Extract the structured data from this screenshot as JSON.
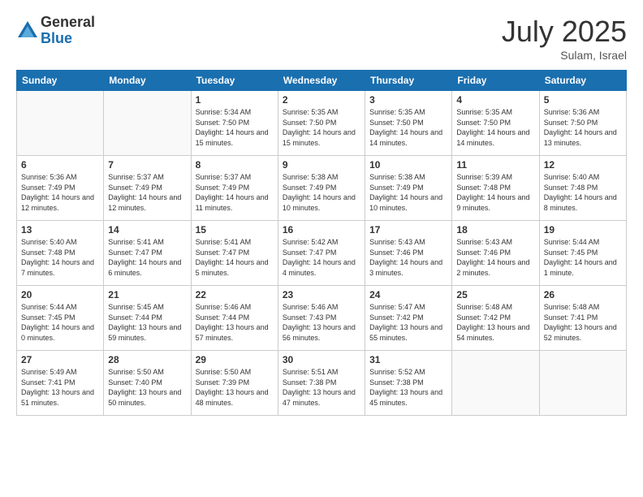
{
  "logo": {
    "general": "General",
    "blue": "Blue"
  },
  "title": "July 2025",
  "location": "Sulam, Israel",
  "days_of_week": [
    "Sunday",
    "Monday",
    "Tuesday",
    "Wednesday",
    "Thursday",
    "Friday",
    "Saturday"
  ],
  "weeks": [
    [
      {
        "day": null
      },
      {
        "day": null
      },
      {
        "day": 1,
        "sunrise": "5:34 AM",
        "sunset": "7:50 PM",
        "daylight": "14 hours and 15 minutes."
      },
      {
        "day": 2,
        "sunrise": "5:35 AM",
        "sunset": "7:50 PM",
        "daylight": "14 hours and 15 minutes."
      },
      {
        "day": 3,
        "sunrise": "5:35 AM",
        "sunset": "7:50 PM",
        "daylight": "14 hours and 14 minutes."
      },
      {
        "day": 4,
        "sunrise": "5:35 AM",
        "sunset": "7:50 PM",
        "daylight": "14 hours and 14 minutes."
      },
      {
        "day": 5,
        "sunrise": "5:36 AM",
        "sunset": "7:50 PM",
        "daylight": "14 hours and 13 minutes."
      }
    ],
    [
      {
        "day": 6,
        "sunrise": "5:36 AM",
        "sunset": "7:49 PM",
        "daylight": "14 hours and 12 minutes."
      },
      {
        "day": 7,
        "sunrise": "5:37 AM",
        "sunset": "7:49 PM",
        "daylight": "14 hours and 12 minutes."
      },
      {
        "day": 8,
        "sunrise": "5:37 AM",
        "sunset": "7:49 PM",
        "daylight": "14 hours and 11 minutes."
      },
      {
        "day": 9,
        "sunrise": "5:38 AM",
        "sunset": "7:49 PM",
        "daylight": "14 hours and 10 minutes."
      },
      {
        "day": 10,
        "sunrise": "5:38 AM",
        "sunset": "7:49 PM",
        "daylight": "14 hours and 10 minutes."
      },
      {
        "day": 11,
        "sunrise": "5:39 AM",
        "sunset": "7:48 PM",
        "daylight": "14 hours and 9 minutes."
      },
      {
        "day": 12,
        "sunrise": "5:40 AM",
        "sunset": "7:48 PM",
        "daylight": "14 hours and 8 minutes."
      }
    ],
    [
      {
        "day": 13,
        "sunrise": "5:40 AM",
        "sunset": "7:48 PM",
        "daylight": "14 hours and 7 minutes."
      },
      {
        "day": 14,
        "sunrise": "5:41 AM",
        "sunset": "7:47 PM",
        "daylight": "14 hours and 6 minutes."
      },
      {
        "day": 15,
        "sunrise": "5:41 AM",
        "sunset": "7:47 PM",
        "daylight": "14 hours and 5 minutes."
      },
      {
        "day": 16,
        "sunrise": "5:42 AM",
        "sunset": "7:47 PM",
        "daylight": "14 hours and 4 minutes."
      },
      {
        "day": 17,
        "sunrise": "5:43 AM",
        "sunset": "7:46 PM",
        "daylight": "14 hours and 3 minutes."
      },
      {
        "day": 18,
        "sunrise": "5:43 AM",
        "sunset": "7:46 PM",
        "daylight": "14 hours and 2 minutes."
      },
      {
        "day": 19,
        "sunrise": "5:44 AM",
        "sunset": "7:45 PM",
        "daylight": "14 hours and 1 minute."
      }
    ],
    [
      {
        "day": 20,
        "sunrise": "5:44 AM",
        "sunset": "7:45 PM",
        "daylight": "14 hours and 0 minutes."
      },
      {
        "day": 21,
        "sunrise": "5:45 AM",
        "sunset": "7:44 PM",
        "daylight": "13 hours and 59 minutes."
      },
      {
        "day": 22,
        "sunrise": "5:46 AM",
        "sunset": "7:44 PM",
        "daylight": "13 hours and 57 minutes."
      },
      {
        "day": 23,
        "sunrise": "5:46 AM",
        "sunset": "7:43 PM",
        "daylight": "13 hours and 56 minutes."
      },
      {
        "day": 24,
        "sunrise": "5:47 AM",
        "sunset": "7:42 PM",
        "daylight": "13 hours and 55 minutes."
      },
      {
        "day": 25,
        "sunrise": "5:48 AM",
        "sunset": "7:42 PM",
        "daylight": "13 hours and 54 minutes."
      },
      {
        "day": 26,
        "sunrise": "5:48 AM",
        "sunset": "7:41 PM",
        "daylight": "13 hours and 52 minutes."
      }
    ],
    [
      {
        "day": 27,
        "sunrise": "5:49 AM",
        "sunset": "7:41 PM",
        "daylight": "13 hours and 51 minutes."
      },
      {
        "day": 28,
        "sunrise": "5:50 AM",
        "sunset": "7:40 PM",
        "daylight": "13 hours and 50 minutes."
      },
      {
        "day": 29,
        "sunrise": "5:50 AM",
        "sunset": "7:39 PM",
        "daylight": "13 hours and 48 minutes."
      },
      {
        "day": 30,
        "sunrise": "5:51 AM",
        "sunset": "7:38 PM",
        "daylight": "13 hours and 47 minutes."
      },
      {
        "day": 31,
        "sunrise": "5:52 AM",
        "sunset": "7:38 PM",
        "daylight": "13 hours and 45 minutes."
      },
      {
        "day": null
      },
      {
        "day": null
      }
    ]
  ],
  "labels": {
    "sunrise": "Sunrise:",
    "sunset": "Sunset:",
    "daylight": "Daylight:"
  }
}
